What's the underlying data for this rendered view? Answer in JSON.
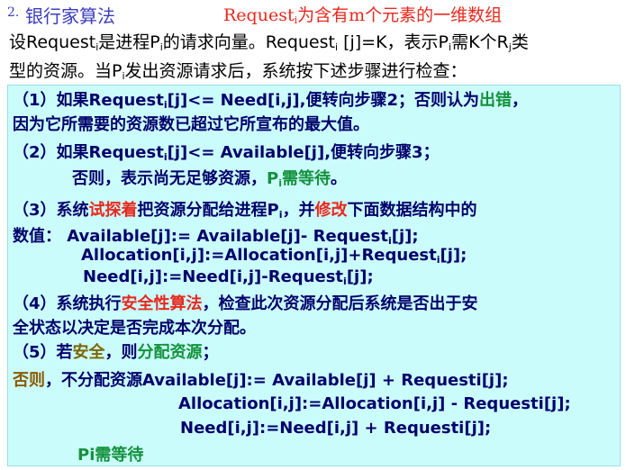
{
  "header": {
    "number": "2.",
    "title": "银行家算法",
    "subtitle_a": "Request",
    "subtitle_sub": "i",
    "subtitle_b": "为含有m个元素的一维数组"
  },
  "intro": {
    "l1_a": "设Request",
    "l1_b": "i",
    "l1_c": "是进程P",
    "l1_d": "i",
    "l1_e": "的请求向量。Request",
    "l1_f": "i",
    "l1_g": " [j]=K，表示P",
    "l1_h": "i",
    "l1_i": "需K个R",
    "l1_j": "j",
    "l1_k": "类",
    "l2_a": "型的资源。当P",
    "l2_b": "i",
    "l2_c": "发出资源请求后，系统按下述步骤进行检查："
  },
  "steps": {
    "s1_a": "（1）如果Request",
    "s1_b": "i",
    "s1_c": "[j]<= Need[i,j],便转向步骤2；否则认为",
    "s1_d": "出错",
    "s1_e": "，",
    "s1_2": "因为它所需要的资源数已超过它所宣布的最大值。",
    "s2_a": "（2）如果Request",
    "s2_b": "i",
    "s2_c": "[j]<= Available[j],便转向步骤3；",
    "s2_2a": "否则，表示尚无足够资源，",
    "s2_2b": "P",
    "s2_2c": "i",
    "s2_2d": "需等待",
    "s2_2e": "。",
    "s3_a": "（3）系统",
    "s3_b": "试探着",
    "s3_c": "把资源分配给进程P",
    "s3_d": "i",
    "s3_e": "，并",
    "s3_f": "修改",
    "s3_g": "下面数据结构中的",
    "s3_2a": "数值：  Available[j]:= Available[j]- Request",
    "s3_2b": "i",
    "s3_2c": "[j];",
    "s3_3a": "Allocation[i,j]:=Allocation[i,j]+Request",
    "s3_3b": "i",
    "s3_3c": "[j];",
    "s3_4a": "Need[i,j]:=Need[i,j]-Request",
    "s3_4b": "i",
    "s3_4c": "[j];",
    "s4_a": "（4）系统执行",
    "s4_b": "安全性算法",
    "s4_c": "，检查此次资源分配后系统是否出于安",
    "s4_2": "全状态以决定是否完成本次分配。",
    "s5_a": "（5）若",
    "s5_b": "安全",
    "s5_c": "，则",
    "s5_d": "分配资源",
    "s5_e": "；",
    "s6_a": "否则",
    "s6_b": "，不分配资源Available[j]:= Available[j] + Requesti[j];",
    "s6_2": "Allocation[i,j]:=Allocation[i,j] - Requesti[j];",
    "s6_3": "Need[i,j]:=Need[i,j] + Requesti[j];",
    "s6_4": "Pi需等待"
  }
}
